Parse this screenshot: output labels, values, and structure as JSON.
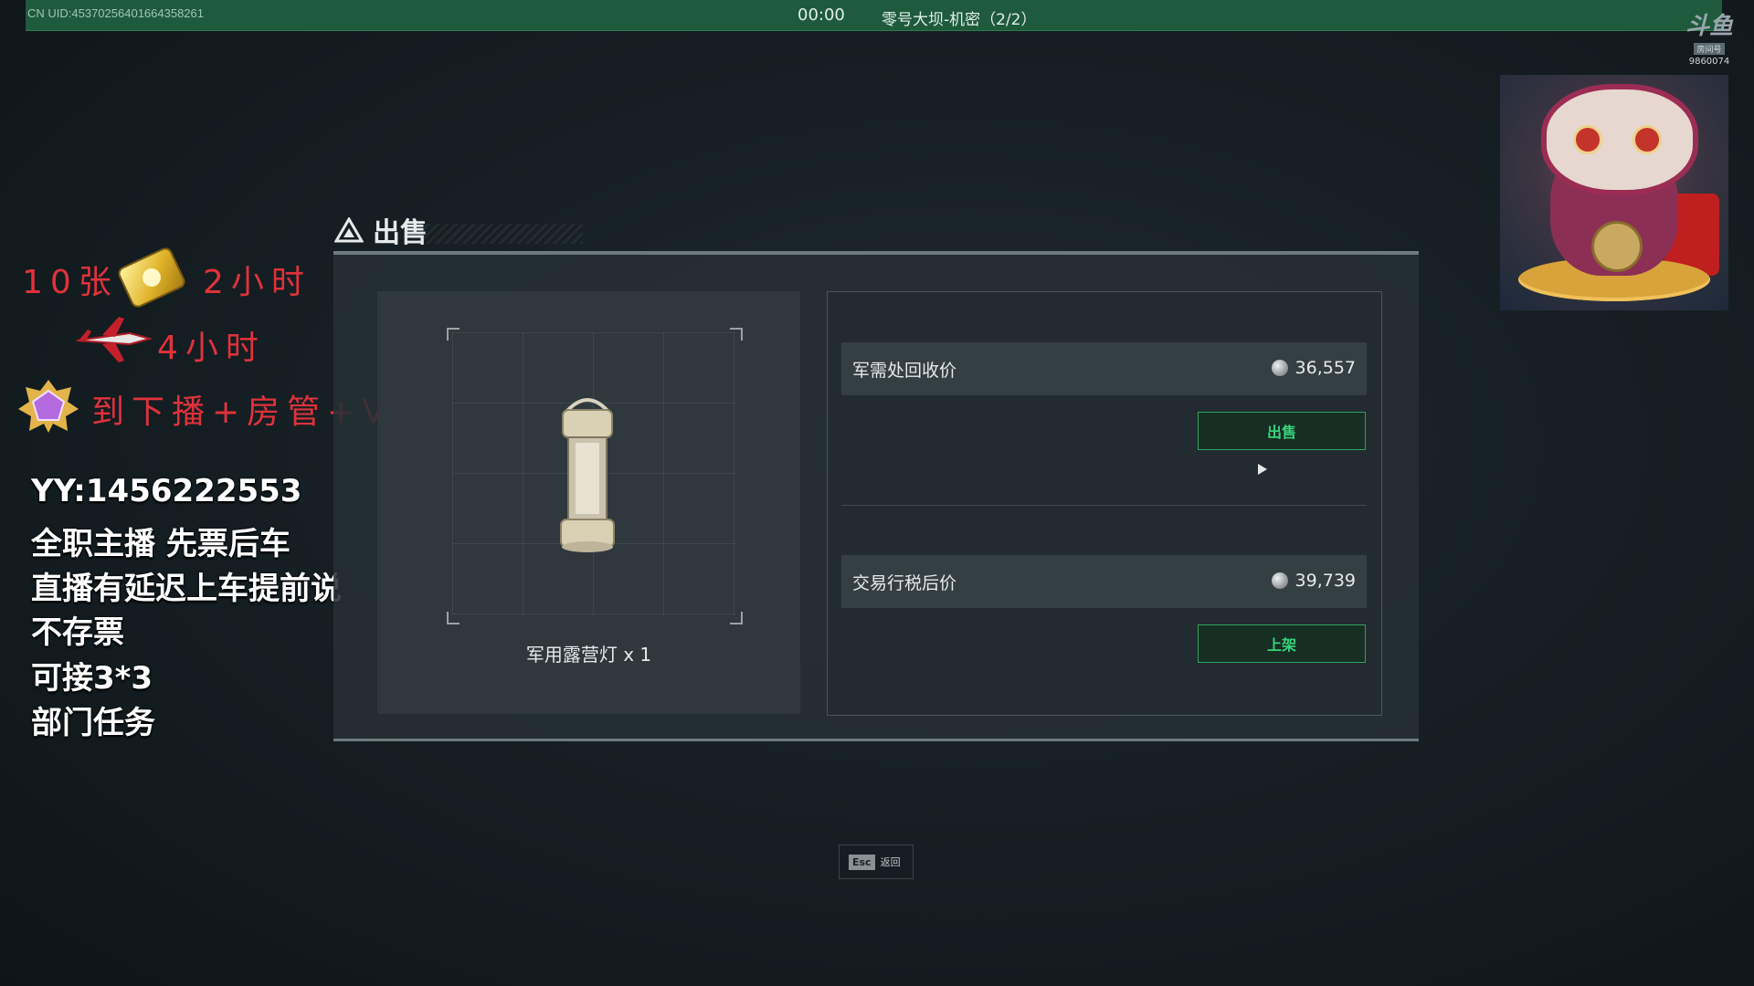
{
  "topbar": {
    "uid": "CN UID:45370256401664358261",
    "timer": "00:00",
    "map": "零号大坝-机密（2/2）"
  },
  "logo": {
    "mark": "斗鱼",
    "sub": "房间号",
    "room_id": "9860074"
  },
  "overlay": {
    "line1_left": "10张",
    "line1_right": "2小时",
    "line2": "4小时",
    "line3": "到下播+房管+V",
    "info": [
      "YY:1456222553",
      "全职主播 先票后车",
      "直播有延迟上车提前说",
      "不存票",
      "可接3*3",
      "部门任务"
    ],
    "icons": [
      "gold-ticket-icon",
      "jet-icon",
      "gem-badge-icon"
    ]
  },
  "dialog": {
    "title": "出售",
    "item_name": "军用露营灯 x 1",
    "merchant": {
      "label": "军需处回收价",
      "value": "36,557",
      "button": "出售"
    },
    "market": {
      "label": "交易行税后价",
      "value": "39,739",
      "button": "上架"
    }
  },
  "footer": {
    "key": "Esc",
    "label": "返回"
  },
  "colors": {
    "accent_green": "#37d47a",
    "topbar": "#1f5a3d",
    "promo_red": "#e0323c"
  }
}
